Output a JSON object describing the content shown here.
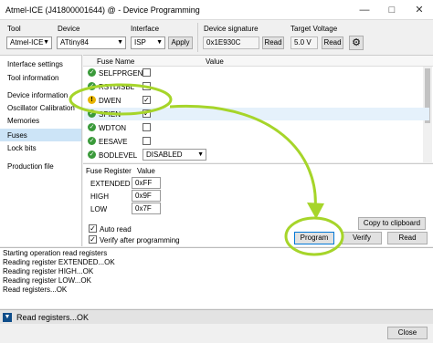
{
  "window": {
    "title": "Atmel-ICE (J41800001644) @ - Device Programming"
  },
  "toolbar": {
    "tool_label": "Tool",
    "tool_value": "Atmel-ICE",
    "device_label": "Device",
    "device_value": "ATtiny84",
    "interface_label": "Interface",
    "interface_value": "ISP",
    "apply_label": "Apply",
    "signature_label": "Device signature",
    "signature_value": "0x1E930C",
    "read_label": "Read",
    "voltage_label": "Target Voltage",
    "voltage_value": "5.0 V"
  },
  "sidebar": {
    "items": [
      {
        "label": "Interface settings"
      },
      {
        "label": "Tool information"
      },
      {
        "label": "Device information"
      },
      {
        "label": "Oscillator Calibration"
      },
      {
        "label": "Memories"
      },
      {
        "label": "Fuses"
      },
      {
        "label": "Lock bits"
      },
      {
        "label": "Production file"
      }
    ]
  },
  "fuses": {
    "col_name": "Fuse Name",
    "col_value": "Value",
    "rows": [
      {
        "name": "SELFPRGEN",
        "status": "ok",
        "checked": false
      },
      {
        "name": "RSTDISBL",
        "status": "ok",
        "checked": false
      },
      {
        "name": "DWEN",
        "status": "warn",
        "checked": true
      },
      {
        "name": "SPIEN",
        "status": "ok",
        "checked": true
      },
      {
        "name": "WDTON",
        "status": "ok",
        "checked": false
      },
      {
        "name": "EESAVE",
        "status": "ok",
        "checked": false
      },
      {
        "name": "BODLEVEL",
        "status": "ok",
        "select": "DISABLED"
      }
    ]
  },
  "registers": {
    "col_reg": "Fuse Register",
    "col_value": "Value",
    "rows": [
      {
        "name": "EXTENDED",
        "value": "0xFF"
      },
      {
        "name": "HIGH",
        "value": "0x9F"
      },
      {
        "name": "LOW",
        "value": "0x7F"
      }
    ]
  },
  "options": {
    "auto_read": "Auto read",
    "verify": "Verify after programming"
  },
  "actions": {
    "copy": "Copy to clipboard",
    "program": "Program",
    "verify": "Verify",
    "read": "Read"
  },
  "log": {
    "lines": [
      "Starting operation read registers",
      "Reading register EXTENDED...OK",
      "Reading register HIGH...OK",
      "Reading register LOW...OK",
      "Read registers...OK"
    ]
  },
  "status": {
    "text": "Read registers...OK",
    "close_label": "Close"
  }
}
